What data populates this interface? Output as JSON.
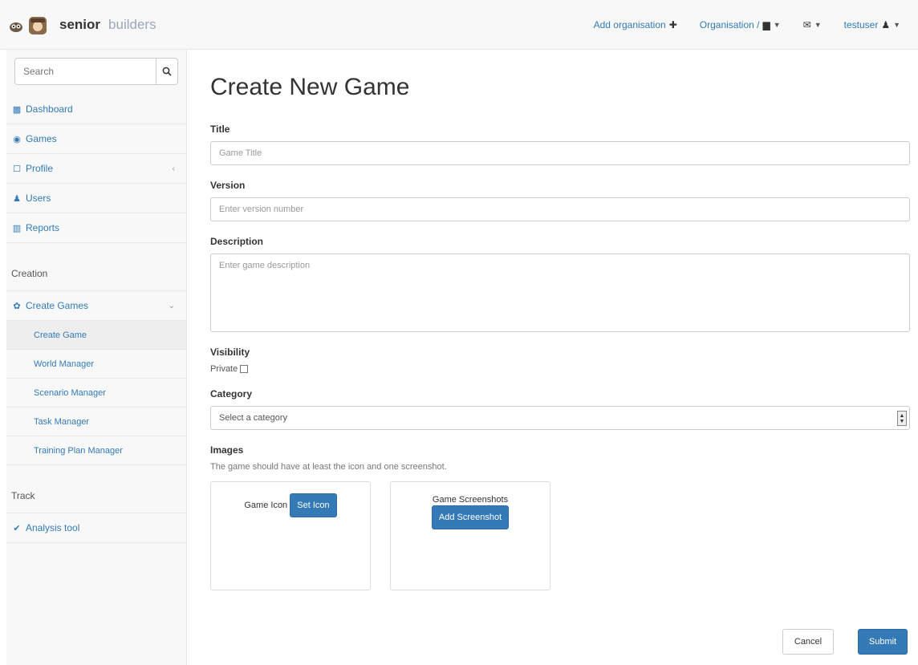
{
  "navbar": {
    "brand_name": "senior",
    "brand_sub": "builders",
    "add_organisation": "Add organisation",
    "organisation": "Organisation /",
    "user": "testuser"
  },
  "sidebar": {
    "search_placeholder": "Search",
    "items": [
      {
        "label": "Dashboard",
        "icon": "dashboard-icon"
      },
      {
        "label": "Games",
        "icon": "gamepad-icon"
      },
      {
        "label": "Profile",
        "icon": "profile-icon"
      },
      {
        "label": "Users",
        "icon": "user-icon"
      },
      {
        "label": "Reports",
        "icon": "bar-chart-icon"
      }
    ],
    "creation_header": "Creation",
    "create_games": "Create Games",
    "sub_items": [
      "Create Game",
      "World Manager",
      "Scenario Manager",
      "Task Manager",
      "Training Plan Manager"
    ],
    "track_header": "Track",
    "analysis_tool": "Analysis tool"
  },
  "main": {
    "title": "Create New Game",
    "title_label": "Title",
    "title_placeholder": "Game Title",
    "version_label": "Version",
    "version_placeholder": "Enter version number",
    "description_label": "Description",
    "description_placeholder": "Enter game description",
    "visibility_label": "Visibility",
    "private_label": "Private",
    "category_label": "Category",
    "category_value": "Select a category",
    "images_label": "Images",
    "images_help": "The game should have at least the icon and one screenshot.",
    "game_icon_label": "Game Icon",
    "set_icon_button": "Set Icon",
    "screenshots_label": "Game Screenshots",
    "add_screenshot_button": "Add Screenshot",
    "cancel_button": "Cancel",
    "submit_button": "Submit"
  },
  "colors": {
    "primary": "#337ab7",
    "navbar_bg": "#f8f8f8",
    "active_item_bg": "#eeeeee"
  }
}
